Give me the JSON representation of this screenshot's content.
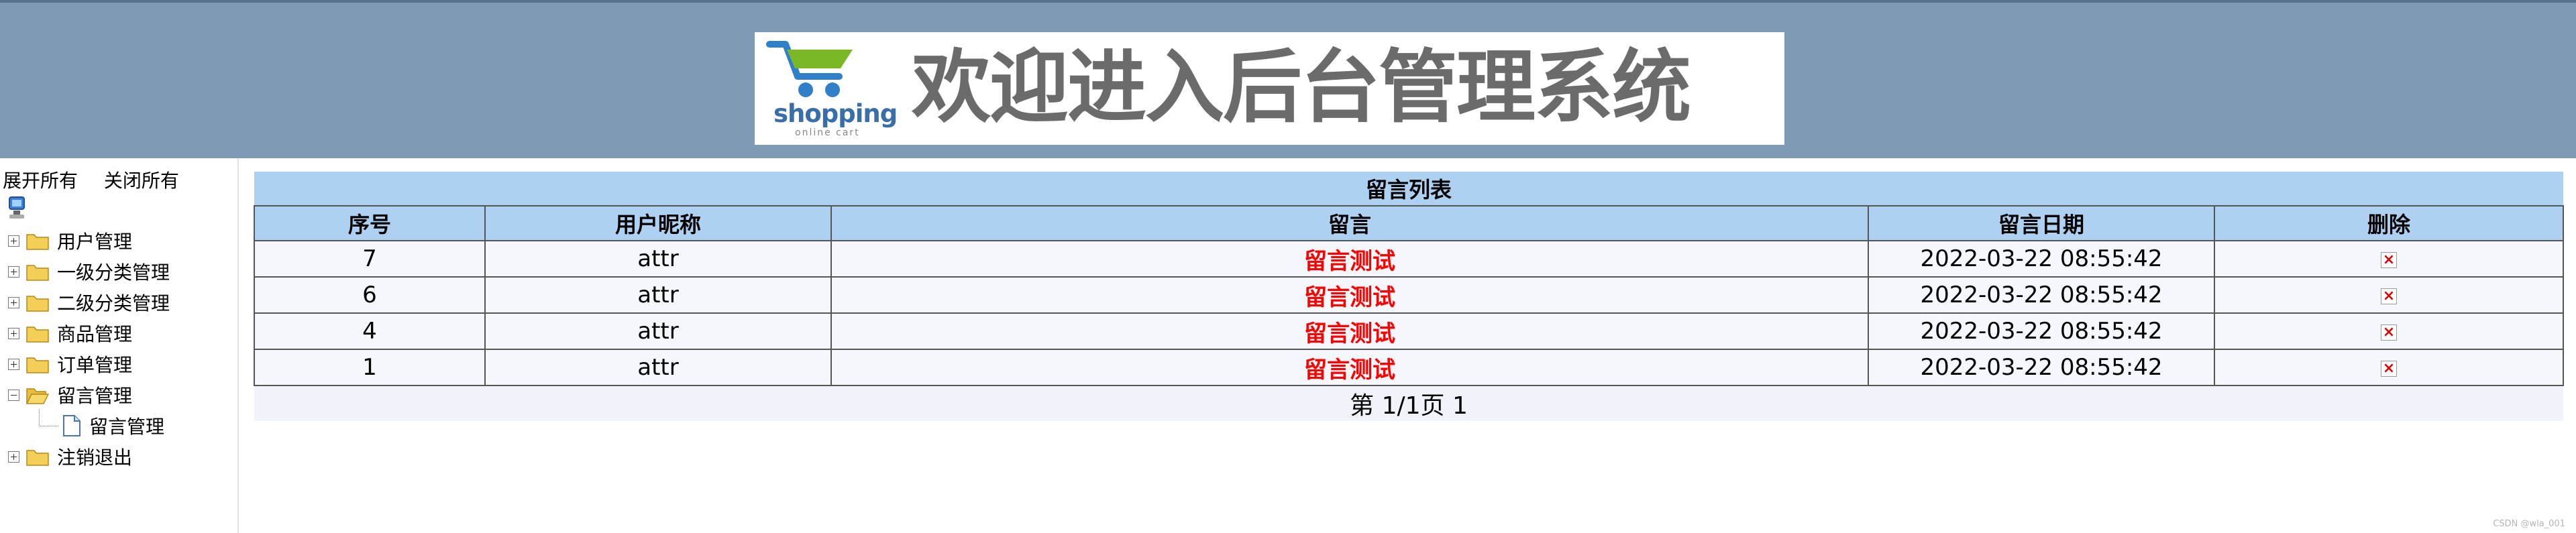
{
  "header": {
    "logo": {
      "word": "shopping",
      "sub": "online cart",
      "colors": {
        "cart": "#2f7fc9",
        "green": "#7ab827"
      }
    },
    "title": "欢迎进入后台管理系统",
    "background": "#7f9ab4"
  },
  "sidebar": {
    "expand_all": "展开所有",
    "collapse_all": "关闭所有",
    "nodes": [
      {
        "label": "用户管理",
        "expanded": false
      },
      {
        "label": "一级分类管理",
        "expanded": false
      },
      {
        "label": "二级分类管理",
        "expanded": false
      },
      {
        "label": "商品管理",
        "expanded": false
      },
      {
        "label": "订单管理",
        "expanded": false
      },
      {
        "label": "留言管理",
        "expanded": true,
        "children": [
          {
            "label": "留言管理"
          }
        ]
      },
      {
        "label": "注销退出",
        "expanded": false
      }
    ]
  },
  "table": {
    "title": "留言列表",
    "columns": [
      "序号",
      "用户昵称",
      "留言",
      "留言日期",
      "删除"
    ],
    "rows": [
      {
        "id": "7",
        "nickname": "attr",
        "message": "留言测试",
        "date": "2022-03-22 08:55:42"
      },
      {
        "id": "6",
        "nickname": "attr",
        "message": "留言测试",
        "date": "2022-03-22 08:55:42"
      },
      {
        "id": "4",
        "nickname": "attr",
        "message": "留言测试",
        "date": "2022-03-22 08:55:42"
      },
      {
        "id": "1",
        "nickname": "attr",
        "message": "留言测试",
        "date": "2022-03-22 08:55:42"
      }
    ],
    "delete_icon": "delete-icon",
    "pager": "第 1/1页 1"
  },
  "watermark": "CSDN @wla_001"
}
